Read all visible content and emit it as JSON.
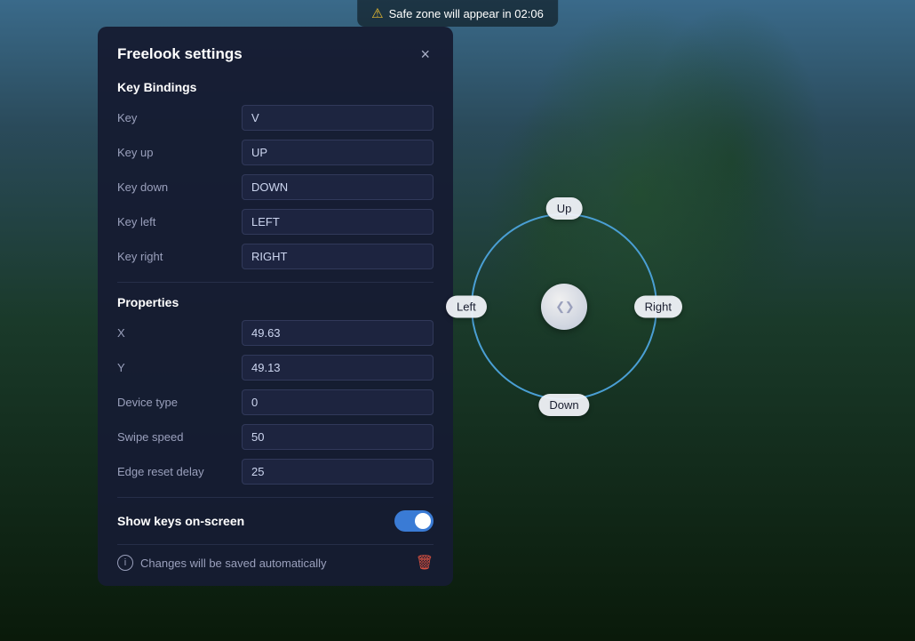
{
  "app": {
    "warning_text": "Safe zone will appear in 02:06"
  },
  "panel": {
    "title": "Freelook settings",
    "close_label": "×",
    "sections": {
      "key_bindings": {
        "title": "Key Bindings",
        "fields": [
          {
            "label": "Key",
            "value": "V"
          },
          {
            "label": "Key up",
            "value": "UP"
          },
          {
            "label": "Key down",
            "value": "DOWN"
          },
          {
            "label": "Key left",
            "value": "LEFT"
          },
          {
            "label": "Key right",
            "value": "RIGHT"
          }
        ]
      },
      "properties": {
        "title": "Properties",
        "fields": [
          {
            "label": "X",
            "value": "49.63"
          },
          {
            "label": "Y",
            "value": "49.13"
          },
          {
            "label": "Device type",
            "value": "0"
          },
          {
            "label": "Swipe speed",
            "value": "50"
          },
          {
            "label": "Edge reset delay",
            "value": "25"
          }
        ]
      }
    },
    "toggle": {
      "label": "Show keys on-screen",
      "enabled": true
    },
    "footer": {
      "text": "Changes will be saved automatically"
    }
  },
  "joystick": {
    "directions": {
      "up": "Up",
      "down": "Down",
      "left": "Left",
      "right": "Right"
    }
  }
}
